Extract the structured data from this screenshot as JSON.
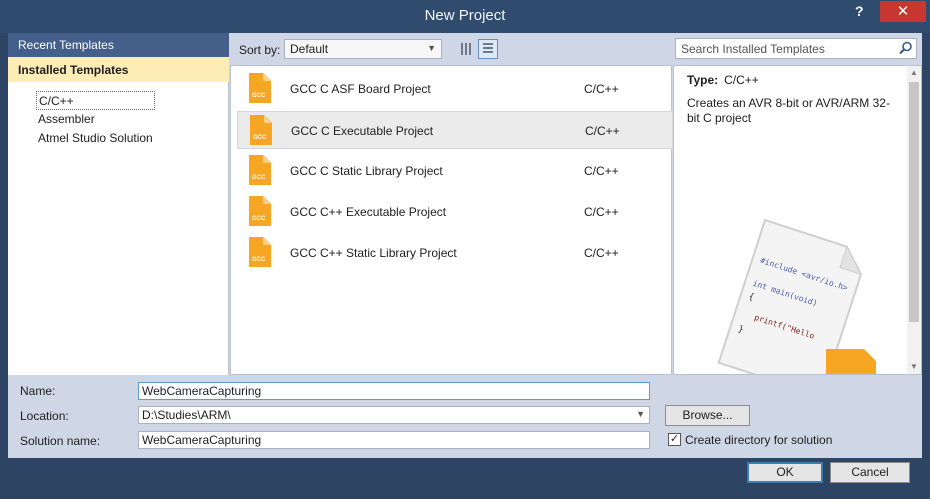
{
  "window": {
    "title": "New Project",
    "help_label": "?",
    "close_label": "✕"
  },
  "left": {
    "recent_label": "Recent Templates",
    "installed_label": "Installed Templates",
    "tree": [
      "C/C++",
      "Assembler",
      "Atmel Studio Solution"
    ]
  },
  "toolbar": {
    "sort_label": "Sort by:",
    "sort_value": "Default",
    "search_placeholder": "Search Installed Templates"
  },
  "templates": [
    {
      "name": "GCC C ASF Board Project",
      "lang": "C/C++"
    },
    {
      "name": "GCC C Executable Project",
      "lang": "C/C++"
    },
    {
      "name": "GCC C Static Library Project",
      "lang": "C/C++"
    },
    {
      "name": "GCC C++ Executable Project",
      "lang": "C/C++"
    },
    {
      "name": "GCC C++ Static Library Project",
      "lang": "C/C++"
    }
  ],
  "selected_template_index": 1,
  "icon_text": "GCC",
  "details": {
    "type_label": "Type:",
    "type_value": "C/C++",
    "description": "Creates an AVR 8-bit or AVR/ARM 32-bit C project",
    "code_lines": [
      "#include <avr/io.h>",
      "int main(void)",
      "{",
      "printf(\"Hello",
      "}"
    ]
  },
  "form": {
    "name_label": "Name:",
    "name_value": "WebCameraCapturing",
    "location_label": "Location:",
    "location_value": "D:\\Studies\\ARM\\",
    "solution_label": "Solution name:",
    "solution_value": "WebCameraCapturing",
    "browse_label": "Browse...",
    "create_dir_label": "Create directory for solution",
    "create_dir_checked": true
  },
  "buttons": {
    "ok_label": "OK",
    "cancel_label": "Cancel"
  },
  "colors": {
    "title_bar": "#2f4b6e",
    "recent_header": "#435f8a",
    "installed_highlight": "#fdecb5",
    "template_icon": "#f6a623",
    "close_button": "#c7372f"
  }
}
